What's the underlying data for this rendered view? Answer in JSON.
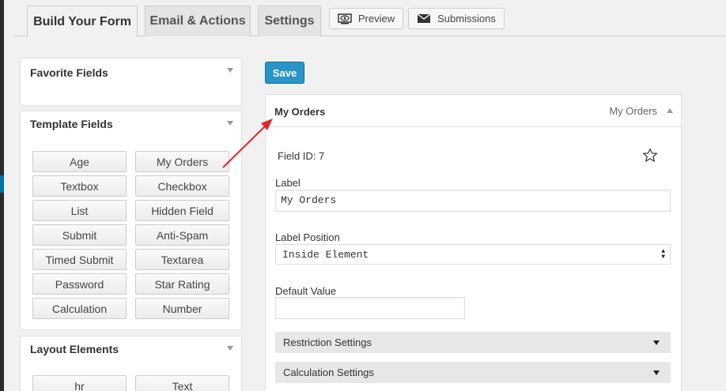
{
  "tabs": [
    {
      "label": "Build Your Form",
      "active": true
    },
    {
      "label": "Email & Actions",
      "active": false
    },
    {
      "label": "Settings",
      "active": false
    }
  ],
  "header_buttons": {
    "preview": {
      "label": "Preview",
      "icon": "eye-icon"
    },
    "submissions": {
      "label": "Submissions",
      "icon": "envelope-icon"
    }
  },
  "sidebar": {
    "favorite_fields": {
      "title": "Favorite Fields"
    },
    "template_fields": {
      "title": "Template Fields",
      "items": [
        "Age",
        "My Orders",
        "Textbox",
        "Checkbox",
        "List",
        "Hidden Field",
        "Submit",
        "Anti-Spam",
        "Timed Submit",
        "Textarea",
        "Password",
        "Star Rating",
        "Calculation",
        "Number"
      ]
    },
    "layout_elements": {
      "title": "Layout Elements",
      "items": [
        "hr",
        "Text"
      ]
    }
  },
  "editor": {
    "save_label": "Save",
    "field_title": "My Orders",
    "field_type": "My Orders",
    "field_id_label": "Field ID: 7",
    "label_caption": "Label",
    "label_value": "My Orders",
    "label_position_caption": "Label Position",
    "label_position_value": "Inside Element",
    "default_value_caption": "Default Value",
    "default_value": "",
    "sections": [
      "Restriction Settings",
      "Calculation Settings"
    ]
  },
  "colors": {
    "primary_button": "#2a95c5",
    "annotation_arrow": "#e3262b"
  }
}
